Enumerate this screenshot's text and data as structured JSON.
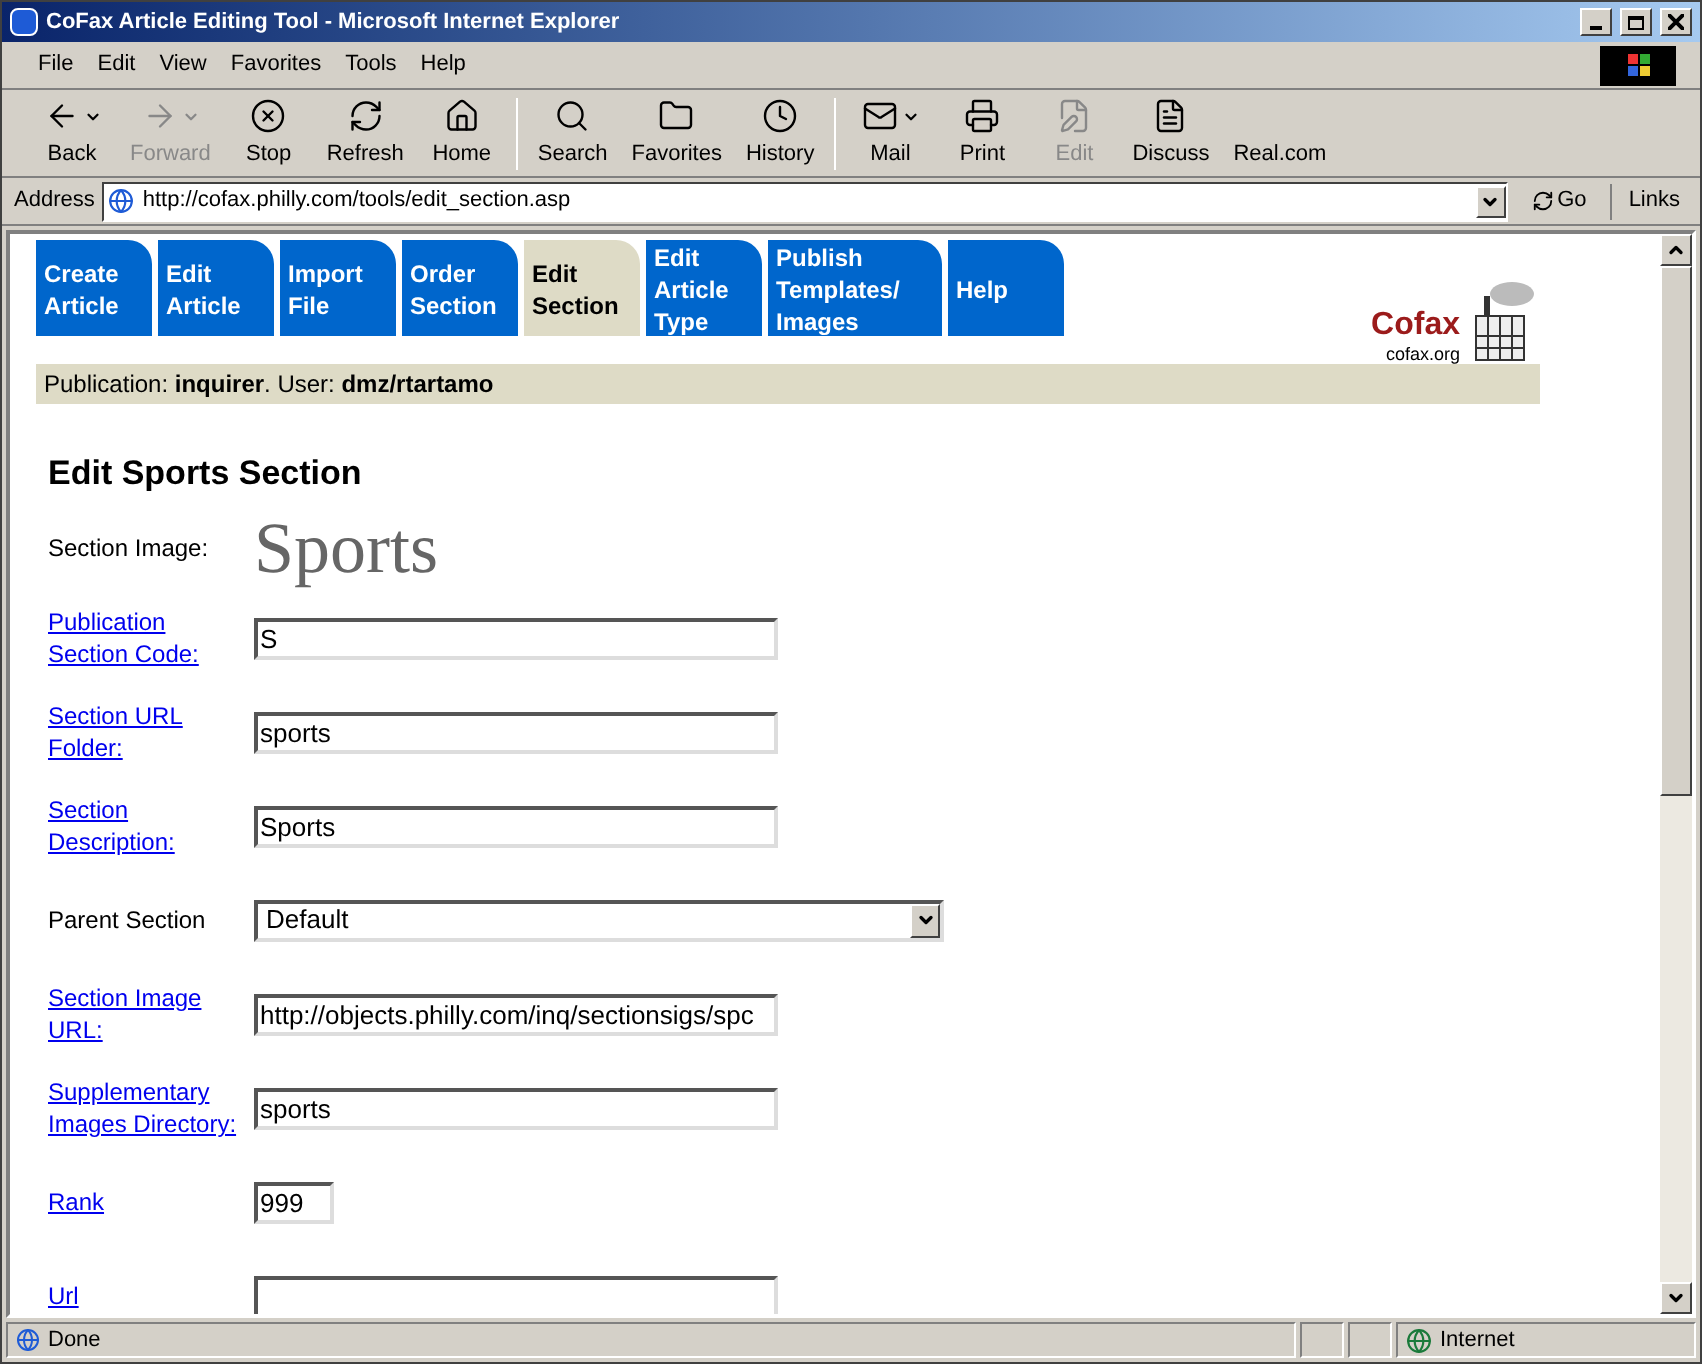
{
  "window": {
    "title": "CoFax Article Editing Tool - Microsoft Internet Explorer"
  },
  "menu": [
    "File",
    "Edit",
    "View",
    "Favorites",
    "Tools",
    "Help"
  ],
  "toolbar": [
    {
      "label": "Back",
      "kind": "back",
      "disabled": false,
      "dropdown": true
    },
    {
      "label": "Forward",
      "kind": "forward",
      "disabled": true,
      "dropdown": true
    },
    {
      "label": "Stop",
      "kind": "stop",
      "disabled": false,
      "dropdown": false
    },
    {
      "label": "Refresh",
      "kind": "refresh",
      "disabled": false,
      "dropdown": false
    },
    {
      "label": "Home",
      "kind": "home",
      "disabled": false,
      "dropdown": false
    },
    {
      "label": "Search",
      "kind": "search",
      "disabled": false,
      "dropdown": false
    },
    {
      "label": "Favorites",
      "kind": "favorites",
      "disabled": false,
      "dropdown": false
    },
    {
      "label": "History",
      "kind": "history",
      "disabled": false,
      "dropdown": false
    },
    {
      "label": "Mail",
      "kind": "mail",
      "disabled": false,
      "dropdown": true
    },
    {
      "label": "Print",
      "kind": "print",
      "disabled": false,
      "dropdown": false
    },
    {
      "label": "Edit",
      "kind": "edit",
      "disabled": true,
      "dropdown": false
    },
    {
      "label": "Discuss",
      "kind": "discuss",
      "disabled": false,
      "dropdown": false
    },
    {
      "label": "Real.com",
      "kind": "text",
      "disabled": false,
      "dropdown": false
    }
  ],
  "address": {
    "label": "Address",
    "value": "http://cofax.philly.com/tools/edit_section.asp",
    "go": "Go",
    "links": "Links"
  },
  "tabs": [
    {
      "label": "Create Article",
      "selected": false
    },
    {
      "label": "Edit Article",
      "selected": false
    },
    {
      "label": "Import File",
      "selected": false
    },
    {
      "label": "Order Section",
      "selected": false
    },
    {
      "label": "Edit Section",
      "selected": true
    },
    {
      "label": "Edit Article Type",
      "selected": false
    },
    {
      "label": "Publish Templates/ Images",
      "selected": false
    },
    {
      "label": "Help",
      "selected": false
    }
  ],
  "info": "Publication: **inquirer**. User: **dmz/rtartamo**",
  "logo": {
    "name": "Cofax",
    "site": "cofax.org"
  },
  "heading": "Edit Sports Section",
  "fields": [
    {
      "label": "Section Image:",
      "link": false,
      "kind": "image",
      "value": "Sports"
    },
    {
      "label": "Publication Section Code:",
      "link": true,
      "kind": "text",
      "value": "S"
    },
    {
      "label": "Section URL Folder:",
      "link": true,
      "kind": "text",
      "value": "sports"
    },
    {
      "label": "Section Description:",
      "link": true,
      "kind": "text",
      "value": "Sports"
    },
    {
      "label": "Parent Section",
      "link": false,
      "kind": "select",
      "value": "Default"
    },
    {
      "label": "Section Image URL:",
      "link": true,
      "kind": "text",
      "value": "http://objects.philly.com/inq/sectionsigs/spc"
    },
    {
      "label": "Supplementary Images Directory:",
      "link": true,
      "kind": "text",
      "value": "sports"
    },
    {
      "label": "Rank",
      "link": true,
      "kind": "short",
      "value": "999"
    },
    {
      "label": "Url",
      "link": true,
      "kind": "text"
    }
  ],
  "status": {
    "text": "Done",
    "zone": "Internet"
  }
}
